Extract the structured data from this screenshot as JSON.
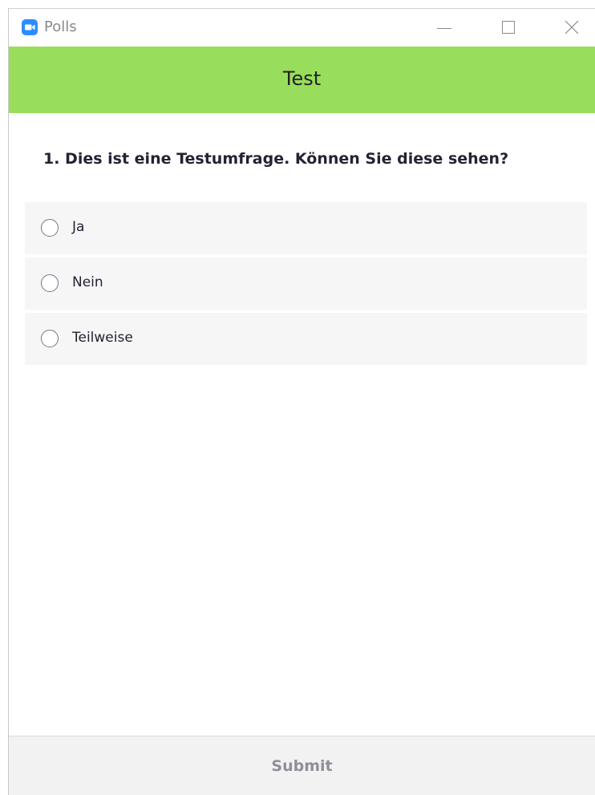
{
  "window": {
    "title": "Polls",
    "app_icon": "zoom-camera-icon",
    "accent_color": "#2d8cff"
  },
  "header": {
    "title": "Test",
    "background_color": "#98dd5c"
  },
  "poll": {
    "question": "1. Dies ist eine Testumfrage. Können Sie diese sehen?",
    "options": [
      {
        "label": "Ja",
        "selected": false
      },
      {
        "label": "Nein",
        "selected": false
      },
      {
        "label": "Teilweise",
        "selected": false
      }
    ]
  },
  "footer": {
    "submit_label": "Submit",
    "submit_enabled": false
  }
}
